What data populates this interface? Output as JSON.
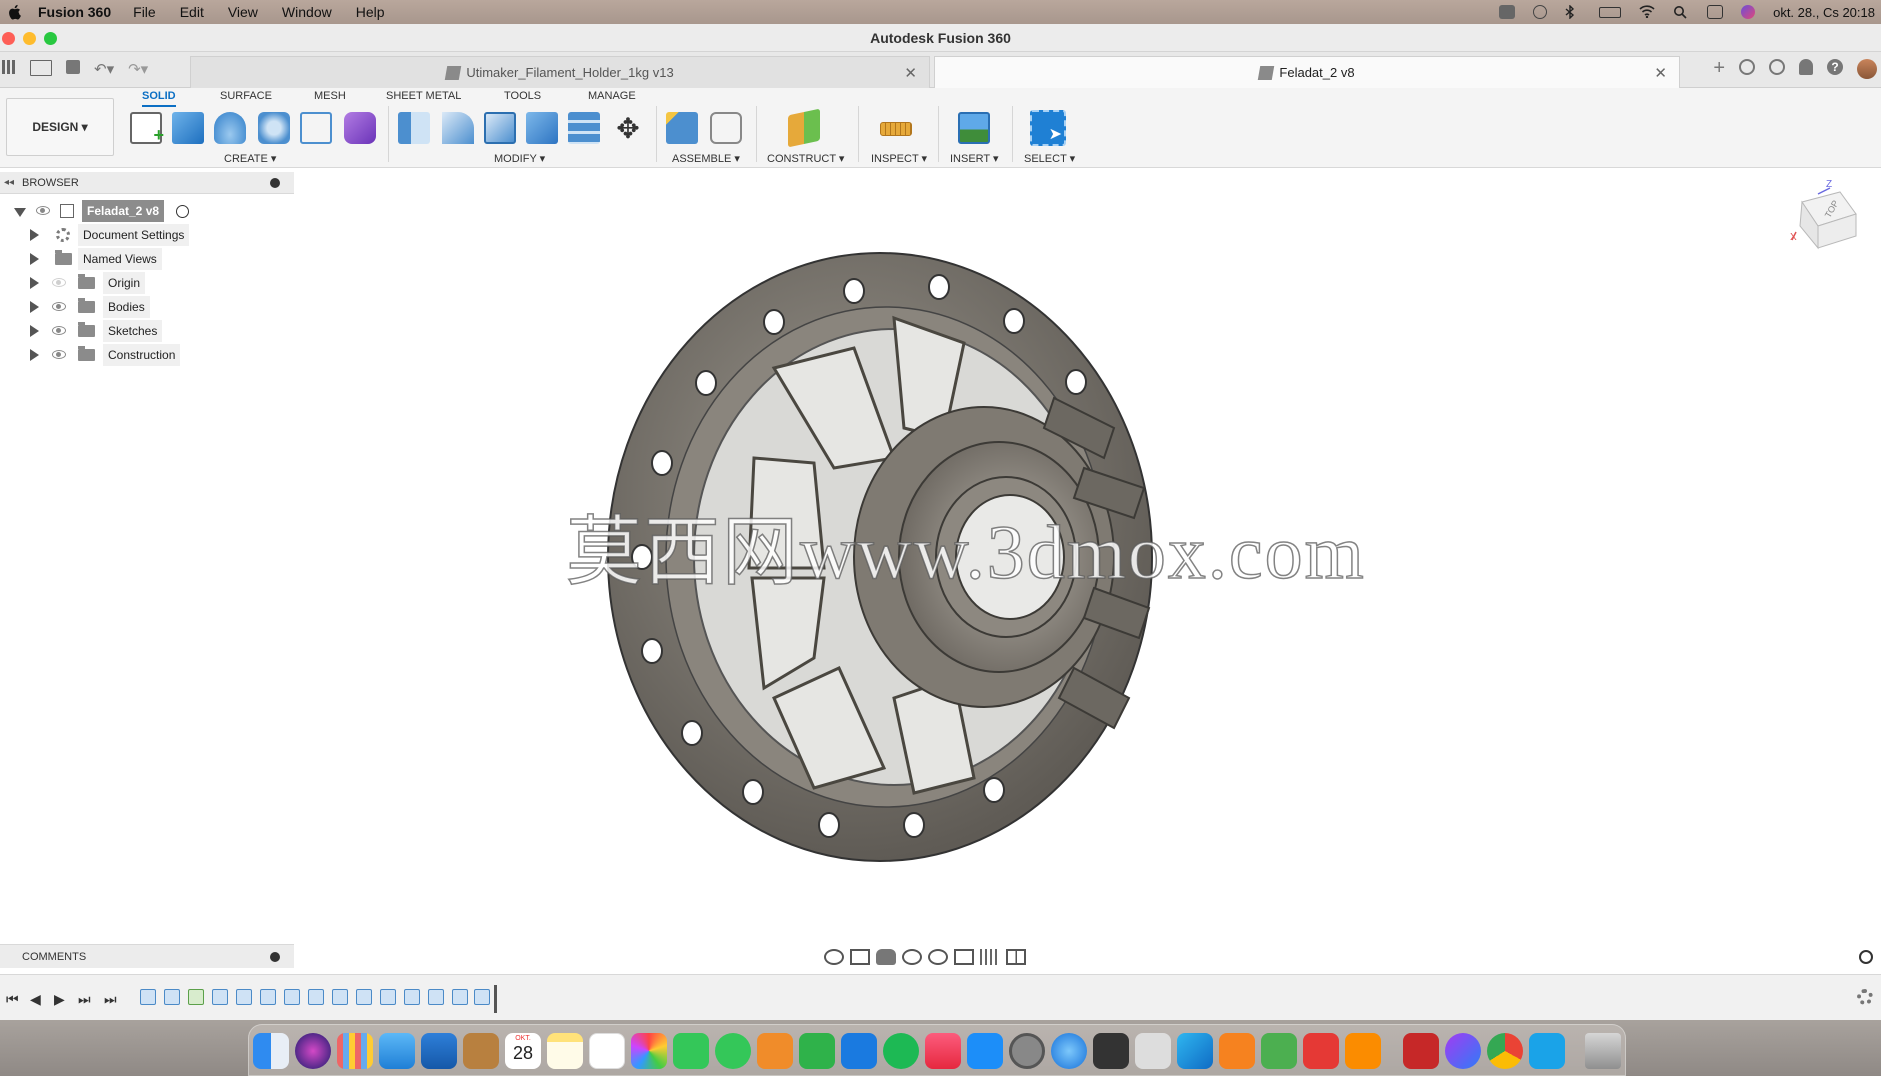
{
  "menubar": {
    "app_name": "Fusion 360",
    "items": [
      "File",
      "Edit",
      "View",
      "Window",
      "Help"
    ],
    "clock": "okt. 28., Cs  20:18"
  },
  "window": {
    "title": "Autodesk Fusion 360"
  },
  "doc_tabs": [
    {
      "label": "Utimaker_Filament_Holder_1kg v13",
      "active": false
    },
    {
      "label": "Feladat_2 v8",
      "active": true
    }
  ],
  "toolbar": {
    "workspace": "DESIGN ▾",
    "tabs": [
      "SOLID",
      "SURFACE",
      "MESH",
      "SHEET METAL",
      "TOOLS",
      "MANAGE"
    ],
    "groups": {
      "create": "CREATE ▾",
      "modify": "MODIFY ▾",
      "assemble": "ASSEMBLE ▾",
      "construct": "CONSTRUCT ▾",
      "inspect": "INSPECT ▾",
      "insert": "INSERT ▾",
      "select": "SELECT ▾"
    }
  },
  "browser": {
    "header": "BROWSER",
    "root": "Feladat_2 v8",
    "items": [
      {
        "label": "Document Settings",
        "kind": "gear",
        "visible": null
      },
      {
        "label": "Named Views",
        "kind": "folder",
        "visible": null
      },
      {
        "label": "Origin",
        "kind": "folder",
        "visible": false
      },
      {
        "label": "Bodies",
        "kind": "folder",
        "visible": true
      },
      {
        "label": "Sketches",
        "kind": "folder",
        "visible": true
      },
      {
        "label": "Construction",
        "kind": "folder",
        "visible": true
      }
    ]
  },
  "viewcube": {
    "face": "TOP",
    "axis_z": "Z",
    "axis_x": "X"
  },
  "watermark": "莫西网www.3dmox.com",
  "comments": {
    "header": "COMMENTS"
  },
  "colors": {
    "accent": "#0b6fc4",
    "model": "#77736b",
    "menubar": "#b0a096"
  },
  "dock": {
    "calendar_month": "OKT.",
    "calendar_day": "28"
  }
}
